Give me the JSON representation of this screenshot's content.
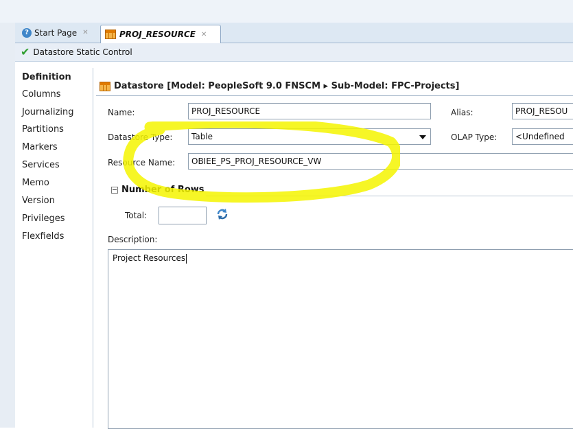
{
  "tabs": [
    {
      "label": "Start Page",
      "icon": "help-icon"
    },
    {
      "label": "PROJ_RESOURCE",
      "icon": "table-icon",
      "active": true
    }
  ],
  "editor_title": "Datastore Static Control",
  "side_nav": [
    {
      "label": "Definition",
      "active": true
    },
    {
      "label": "Columns"
    },
    {
      "label": "Journalizing"
    },
    {
      "label": "Partitions"
    },
    {
      "label": "Markers"
    },
    {
      "label": "Services"
    },
    {
      "label": "Memo"
    },
    {
      "label": "Version"
    },
    {
      "label": "Privileges"
    },
    {
      "label": "Flexfields"
    }
  ],
  "header": "Datastore [Model: PeopleSoft 9.0 FNSCM ▸ Sub-Model: FPC-Projects]",
  "form": {
    "name_label": "Name:",
    "name_value": "PROJ_RESOURCE",
    "alias_label": "Alias:",
    "alias_value": "PROJ_RESOU",
    "datastore_type_label": "Datastore Type:",
    "datastore_type_value": "Table",
    "olap_type_label": "OLAP Type:",
    "olap_type_value": "<Undefined",
    "resource_name_label": "Resource Name:",
    "resource_name_value": "OBIEE_PS_PROJ_RESOURCE_VW"
  },
  "rows_section": {
    "title": "Number of Rows",
    "total_label": "Total:",
    "total_value": ""
  },
  "description": {
    "label": "Description:",
    "value": "Project Resources"
  },
  "colors": {
    "highlight": "#f4f400",
    "accent": "#3f86c9",
    "tab_bar": "#dde8f3"
  }
}
